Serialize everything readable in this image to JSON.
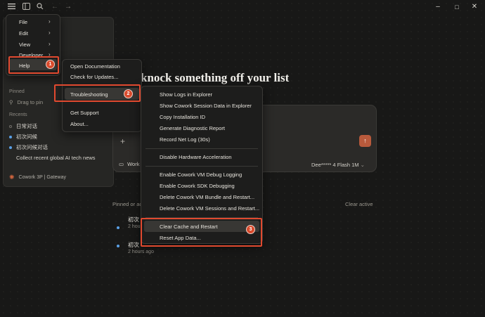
{
  "titlebar": {
    "menu_icon": "hamburger-icon",
    "sidebar_icon": "sidebar-toggle-icon",
    "search_icon": "search-icon",
    "minimize": "–",
    "maximize": "□",
    "close": "✕"
  },
  "sidebar": {
    "pinned_label": "Pinned",
    "drag_to_pin": "Drag to pin",
    "recents_label": "Recents",
    "recents": [
      "日常对话",
      "初次问候",
      "初次问候对话",
      "Collect recent global AI tech news"
    ],
    "footer": "Cowork 3P | Gateway"
  },
  "main": {
    "headline": "knock something off your list",
    "plus": "+",
    "send": "↑",
    "workspace_label": "Work",
    "model": "Dee***** 4 Flash 1M",
    "list_header_left": "Pinned or ac",
    "list_header_right": "Clear active",
    "items": [
      {
        "title": "初次",
        "time": "2 hou"
      },
      {
        "title": "初次",
        "time": "2 hours ago"
      }
    ]
  },
  "app_menu": {
    "items": [
      "File",
      "Edit",
      "View",
      "Developer",
      "Help"
    ]
  },
  "help_menu": {
    "items": [
      "Open Documentation",
      "Check for Updates...",
      "Troubleshooting",
      "Get Support",
      "About..."
    ]
  },
  "troubleshooting_menu": {
    "group1": [
      "Show Logs in Explorer",
      "Show Cowork Session Data in Explorer",
      "Copy Installation ID",
      "Generate Diagnostic Report",
      "Record Net Log (30s)"
    ],
    "group2": [
      "Disable Hardware Acceleration"
    ],
    "group3": [
      "Enable Cowork VM Debug Logging",
      "Enable Cowork SDK Debugging",
      "Delete Cowork VM Bundle and Restart...",
      "Delete Cowork VM Sessions and Restart..."
    ],
    "group4": [
      "Clear Cache and Restart",
      "Reset App Data..."
    ]
  },
  "annotations": {
    "badge1": "1",
    "badge2": "2",
    "badge3": "3",
    "color": "#e0492f"
  }
}
